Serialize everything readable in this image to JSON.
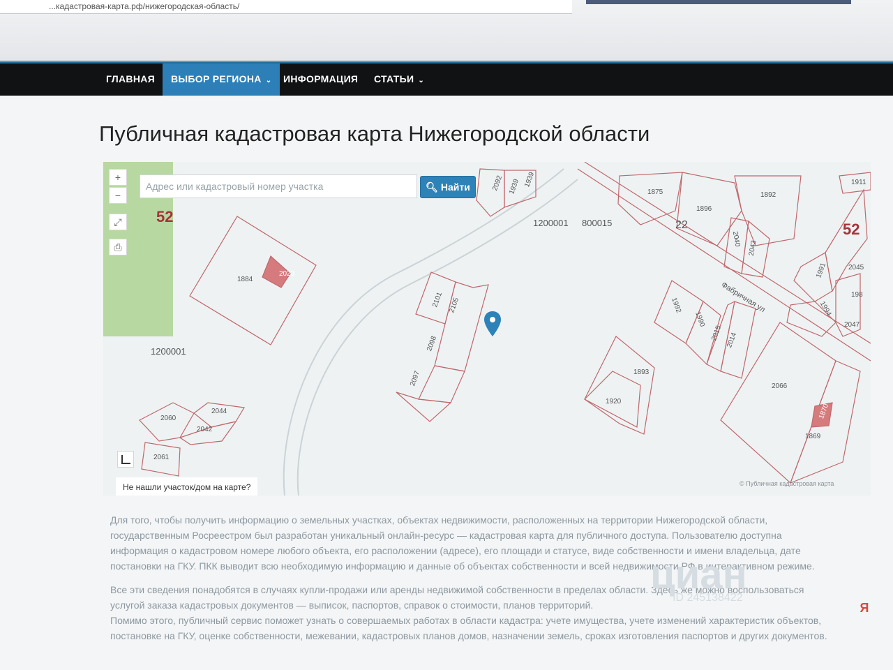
{
  "browser": {
    "url": "...кадастровая-карта.рф/нижегородская-область/"
  },
  "nav": {
    "items": [
      {
        "label": "ГЛАВНАЯ"
      },
      {
        "label": "ВЫБОР РЕГИОНА"
      },
      {
        "label": "ИНФОРМАЦИЯ"
      },
      {
        "label": "СТАТЬИ"
      }
    ]
  },
  "page": {
    "title": "Публичная кадастровая карта Нижегородской области"
  },
  "map": {
    "search_placeholder": "Адрес или кадастровый номер участка",
    "search_button": "Найти",
    "zoom_in": "+",
    "zoom_out": "−",
    "not_found_link": "Не нашли участок/дом на карте?",
    "attribution": "© Публичная кадастровая карта",
    "region_numbers": [
      "52",
      "52"
    ],
    "labels": {
      "block_left": "1200001",
      "block_top": "1200001",
      "block_top2": "800015",
      "quarter_22": "22",
      "street": "Фабричная ул"
    },
    "parcel_numbers": [
      "1884",
      "2023",
      "2101",
      "2105",
      "2098",
      "2097",
      "2092",
      "1939",
      "1939",
      "1875",
      "1896",
      "1892",
      "2040",
      "2043",
      "1991",
      "2045",
      "198",
      "1994",
      "2047",
      "1992",
      "1990",
      "2015",
      "2014",
      "1893",
      "1920",
      "2066",
      "1869",
      "1870",
      "2060",
      "2044",
      "2042",
      "2061",
      "1911"
    ]
  },
  "text": {
    "paragraph1": "Для того, чтобы получить информацию о земельных участках, объектах недвижимости, расположенных на территории Нижегородской области, государственным Росреестром был разработан уникальный онлайн-ресурс — кадастровая карта для публичного доступа. Пользователю доступна информация о кадастровом номере любого объекта, его расположении (адресе), его площади и статусе, виде собственности и имени владельца, дате постановки на ГКУ. ПКК выводит всю необходимую информацию и данные об объектах собственности и всей недвижимости РФ в интерактивном режиме.",
    "paragraph2": "Все эти сведения понадобятся в случаях купли-продажи или аренды недвижимой собственности в пределах области. Здесь же можно воспользоваться услугой заказа кадастровых документов — выписок, паспортов, справок о стоимости, планов территорий.",
    "paragraph3": "Помимо этого, публичный сервис поможет узнать о совершаемых работах в области кадастра: учете имущества, учете изменений характеристик объектов, постановке на ГКУ, оценке собственности, межевании, кадастровых планов домов, назначении земель, сроках изготовления паспортов и других документов."
  },
  "watermark": {
    "brand": "циан",
    "id": "ID 245138422"
  },
  "colors": {
    "nav_bg": "#101214",
    "nav_active": "#2d7fb8",
    "parcel_line": "#c0676b",
    "button": "#2d83b8",
    "pin": "#2d83b8"
  }
}
